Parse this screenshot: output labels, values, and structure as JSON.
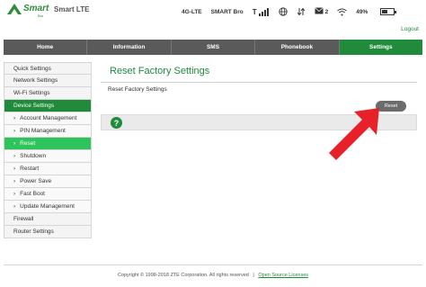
{
  "header": {
    "brand": "Smart",
    "brand_sub": "Bro",
    "product": "Smart LTE",
    "network_type": "4G-LTE",
    "carrier": "SMART Bro",
    "sms_count": "2",
    "battery_percent": "49%",
    "battery_level": 0.49,
    "logout": "Logout"
  },
  "nav": {
    "tabs": [
      {
        "label": "Home"
      },
      {
        "label": "Information"
      },
      {
        "label": "SMS"
      },
      {
        "label": "Phonebook"
      },
      {
        "label": "Settings"
      }
    ],
    "active": "Settings"
  },
  "sidebar": {
    "items": [
      {
        "label": "Quick Settings"
      },
      {
        "label": "Network Settings"
      },
      {
        "label": "Wi-Fi Settings"
      },
      {
        "label": "Device Settings"
      },
      {
        "label": "Account Management"
      },
      {
        "label": "PIN Management"
      },
      {
        "label": "Reset"
      },
      {
        "label": "Shutdown"
      },
      {
        "label": "Restart"
      },
      {
        "label": "Power Save"
      },
      {
        "label": "Fast Boot"
      },
      {
        "label": "Update Management"
      },
      {
        "label": "Firewall"
      },
      {
        "label": "Router Settings"
      }
    ]
  },
  "main": {
    "title": "Reset Factory Settings",
    "section_label": "Reset Factory Settings",
    "reset_button": "Reset",
    "help_symbol": "?"
  },
  "footer": {
    "copyright": "Copyright © 1998-2018 ZTE Corporation. All rights reserved",
    "separator": "|",
    "open_source": "Open Source Licenses"
  },
  "colors": {
    "accent_green": "#1f8b3b",
    "active_sub_green": "#2ec45c",
    "nav_gray": "#5a5a5a",
    "arrow_red": "#e8202a"
  },
  "icons": [
    "smart-logo-icon",
    "signal-icon",
    "network-icon",
    "transfer-icon",
    "sms-icon",
    "wifi-icon",
    "battery-icon",
    "help-icon",
    "arrow-icon"
  ]
}
